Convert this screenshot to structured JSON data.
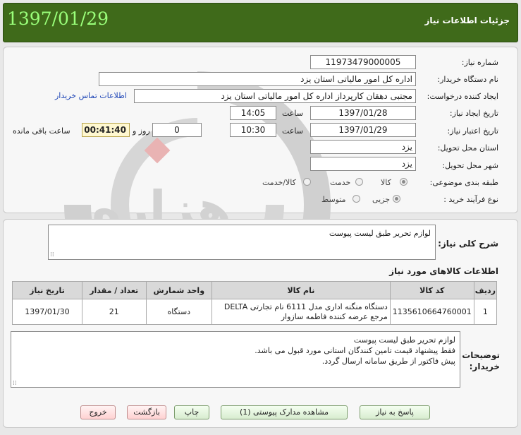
{
  "header": {
    "date": "1397/01/29",
    "title": "جزئیات اطلاعات نیاز"
  },
  "form": {
    "need_number_label": "شماره نیاز:",
    "need_number": "11973479000005",
    "buyer_org_label": "نام دستگاه خریدار:",
    "buyer_org": "اداره کل امور مالیاتی استان یزد",
    "requester_label": "ایجاد کننده درخواست:",
    "requester": "مجتبی  دهقان کارپرداز اداره کل امور مالیاتی استان یزد",
    "contact_link": "اطلاعات تماس خریدار",
    "created_label": "تاریخ ایجاد نیاز:",
    "created_date": "1397/01/28",
    "time_label": "ساعت",
    "created_time": "14:05",
    "valid_label": "تاریخ اعتبار نیاز:",
    "valid_date": "1397/01/29",
    "valid_time": "10:30",
    "days_value": "0",
    "days_label": "روز و",
    "countdown": "00:41:40",
    "remaining_label": "ساعت باقی مانده",
    "province_label": "استان محل تحویل:",
    "province": "یزد",
    "city_label": "شهر محل تحویل:",
    "city": "یزد",
    "category_label": "طبقه بندی موضوعی:",
    "category_options": [
      "کالا",
      "خدمت",
      "کالا/خدمت"
    ],
    "process_label": "نوع فرآیند خرید :",
    "process_options": [
      "جزیی",
      "متوسط"
    ]
  },
  "summary": {
    "label": "شرح کلی نیاز:",
    "text": "لوازم تحریر طبق لیست پیوست"
  },
  "goods": {
    "title": "اطلاعات کالاهای مورد نیاز",
    "headers": [
      "ردیف",
      "کد کالا",
      "نام کالا",
      "واحد شمارش",
      "تعداد / مقدار",
      "تاریخ نیاز"
    ],
    "rows": [
      {
        "row": "1",
        "code": "1135610664760001",
        "name": "دستگاه منگنه اداری مدل 6111 نام تجارتی DELTA مرجع عرضه کننده فاطمه سازوار",
        "unit": "دستگاه",
        "qty": "21",
        "date": "1397/01/30"
      }
    ]
  },
  "buyer_notes": {
    "label_line1": "توضیحات",
    "label_line2": "خریدار:",
    "lines": [
      "لوازم تحریر طبق لیست پیوست",
      "فقط پیشنهاد قیمت تامین کنندگان استانی مورد قبول می باشد.",
      "پیش فاکتور از طریق سامانه ارسال گردد."
    ]
  },
  "buttons": {
    "reply": "پاسخ به نیاز",
    "view_docs": "مشاهده مدارک پیوستی (1)",
    "print": "چاپ",
    "back": "بازگشت",
    "exit": "خروج"
  }
}
